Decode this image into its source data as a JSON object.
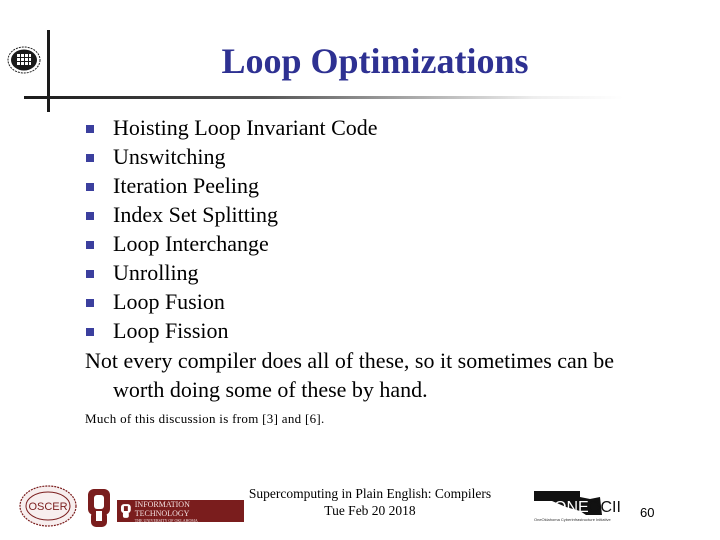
{
  "slide": {
    "title": "Loop Optimizations",
    "bullets": [
      {
        "label": "Hoisting Loop Invariant Code"
      },
      {
        "label": "Unswitching"
      },
      {
        "label": "Iteration Peeling"
      },
      {
        "label": "Index Set Splitting"
      },
      {
        "label": "Loop Interchange"
      },
      {
        "label": "Unrolling"
      },
      {
        "label": "Loop Fusion"
      },
      {
        "label": "Loop Fission"
      }
    ],
    "note_line1": "Not every compiler does all of these, so it sometimes can be",
    "note_line2": "worth doing some of these by hand.",
    "source": "Much of this discussion is from [3] and [6]."
  },
  "footer": {
    "course": "Supercomputing in Plain English: Compilers",
    "date": "Tue Feb 20 2018",
    "page_number": "60",
    "it_logo_text": "INFORMATION TECHNOLOGY",
    "it_logo_subtext": "THE UNIVERSITY OF OKLAHOMA",
    "oscer_text": "OSCER",
    "oneocii_text": "ONEOCII",
    "oneocii_subtext": "OneOklahoma Cyberinfrastructure Initiative"
  },
  "colors": {
    "title": "#2e3192",
    "bullet": "#3b3f9e",
    "ou_crimson": "#7a1d1d"
  }
}
